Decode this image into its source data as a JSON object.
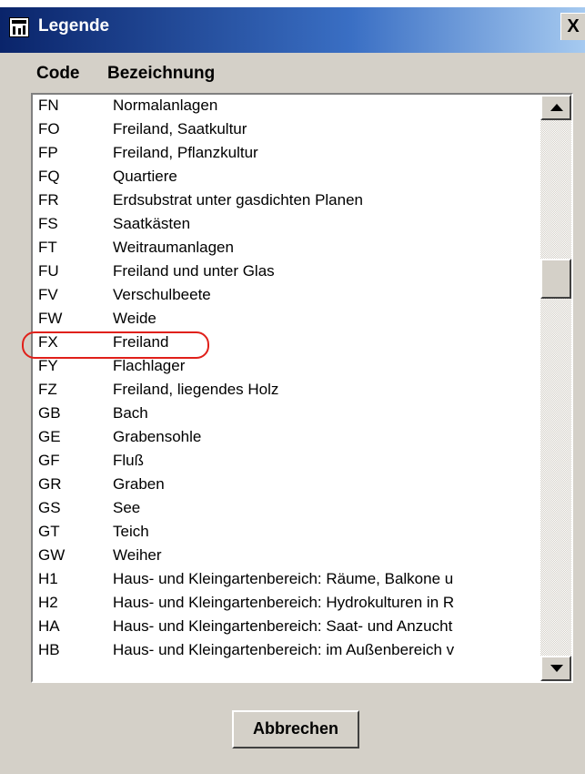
{
  "window": {
    "title": "Legende",
    "close_label": "X"
  },
  "columns": {
    "code": "Code",
    "bezeichnung": "Bezeichnung"
  },
  "rows": [
    {
      "code": "FN",
      "bezeichnung": "Normalanlagen"
    },
    {
      "code": "FO",
      "bezeichnung": "Freiland, Saatkultur"
    },
    {
      "code": "FP",
      "bezeichnung": "Freiland, Pflanzkultur"
    },
    {
      "code": "FQ",
      "bezeichnung": "Quartiere"
    },
    {
      "code": "FR",
      "bezeichnung": "Erdsubstrat unter gasdichten Planen"
    },
    {
      "code": "FS",
      "bezeichnung": "Saatkästen"
    },
    {
      "code": "FT",
      "bezeichnung": "Weitraumanlagen"
    },
    {
      "code": "FU",
      "bezeichnung": "Freiland und unter Glas"
    },
    {
      "code": "FV",
      "bezeichnung": "Verschulbeete"
    },
    {
      "code": "FW",
      "bezeichnung": "Weide"
    },
    {
      "code": "FX",
      "bezeichnung": "Freiland"
    },
    {
      "code": "FY",
      "bezeichnung": "Flachlager"
    },
    {
      "code": "FZ",
      "bezeichnung": "Freiland, liegendes Holz"
    },
    {
      "code": "GB",
      "bezeichnung": "Bach"
    },
    {
      "code": "GE",
      "bezeichnung": "Grabensohle"
    },
    {
      "code": "GF",
      "bezeichnung": "Fluß"
    },
    {
      "code": "GR",
      "bezeichnung": "Graben"
    },
    {
      "code": "GS",
      "bezeichnung": "See"
    },
    {
      "code": "GT",
      "bezeichnung": "Teich"
    },
    {
      "code": "GW",
      "bezeichnung": "Weiher"
    },
    {
      "code": "H1",
      "bezeichnung": "Haus- und Kleingartenbereich: Räume, Balkone u"
    },
    {
      "code": "H2",
      "bezeichnung": "Haus- und Kleingartenbereich: Hydrokulturen in R"
    },
    {
      "code": "HA",
      "bezeichnung": "Haus- und Kleingartenbereich: Saat- und Anzucht"
    },
    {
      "code": "HB",
      "bezeichnung": "Haus- und Kleingartenbereich: im Außenbereich v"
    }
  ],
  "highlighted_code": "FX",
  "buttons": {
    "abbrechen": "Abbrechen"
  },
  "colors": {
    "highlight_ring": "#e0201a",
    "title_bar": "#0a246a",
    "face": "#d4d0c8"
  }
}
